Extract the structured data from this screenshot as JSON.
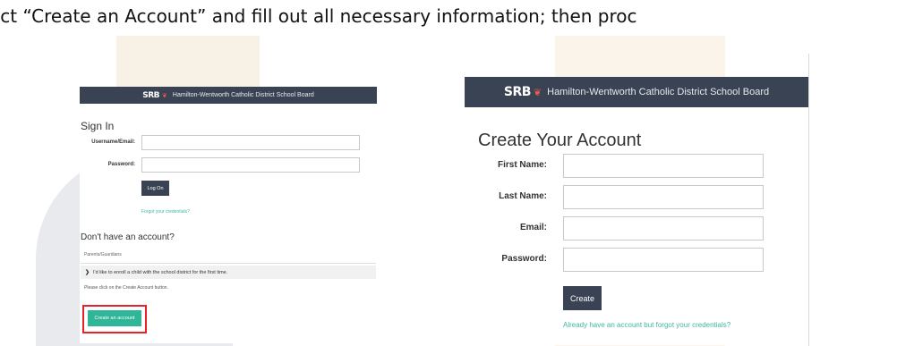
{
  "instruction": "ect “Create an Account” and fill out all necessary information; then proc",
  "colors": {
    "header_bg": "#3a4354",
    "accent_teal": "#2fb598",
    "highlight_red": "#e4232b",
    "link": "#3fb6a3"
  },
  "left_panel": {
    "header": {
      "logo_text": "SRB",
      "board_name": "Hamilton-Wentworth Catholic District School Board"
    },
    "sign_in_title": "Sign In",
    "username_label": "Username/Email:",
    "password_label": "Password:",
    "logon_button": "Log On",
    "forgot_link": "Forgot your credentials?",
    "no_account_heading": "Don't have an account?",
    "tab_label": "Parents/Guardians",
    "enroll_text": "I'd like to enroll a child with the school district for the first time.",
    "please_text": "Please click on the Create Account button.",
    "create_account_button": "Create an account"
  },
  "right_panel": {
    "header": {
      "logo_text": "SRB",
      "board_name": "Hamilton-Wentworth Catholic District School Board"
    },
    "title": "Create Your Account",
    "first_name_label": "First Name:",
    "last_name_label": "Last Name:",
    "email_label": "Email:",
    "password_label": "Password:",
    "create_button": "Create",
    "forgot_link": "Already have an account but forgot your credentials?"
  }
}
